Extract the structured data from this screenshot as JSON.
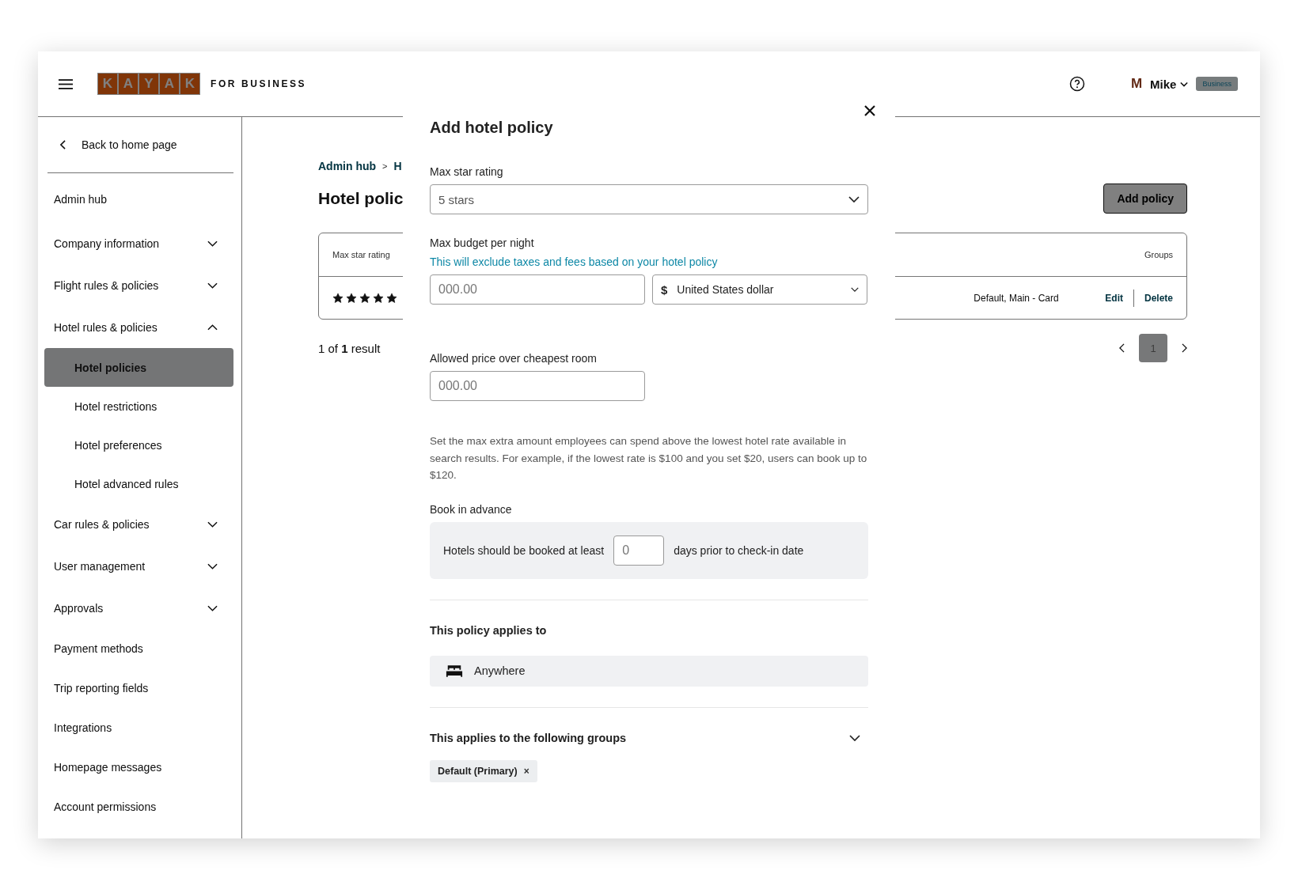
{
  "header": {
    "logo_letters": [
      "K",
      "A",
      "Y",
      "A",
      "K"
    ],
    "logo_suffix": "FOR BUSINESS",
    "user": {
      "avatar": "M",
      "name": "Mike",
      "badge": "Business"
    }
  },
  "sidebar": {
    "back": "Back to home page",
    "items": [
      {
        "label": "Admin hub",
        "kind": "link"
      },
      {
        "label": "Company information",
        "kind": "group",
        "expanded": false
      },
      {
        "label": "Flight rules & policies",
        "kind": "group",
        "expanded": false
      },
      {
        "label": "Hotel rules & policies",
        "kind": "group",
        "expanded": true,
        "children": [
          {
            "label": "Hotel policies",
            "selected": true
          },
          {
            "label": "Hotel restrictions",
            "selected": false
          },
          {
            "label": "Hotel preferences",
            "selected": false
          },
          {
            "label": "Hotel advanced rules",
            "selected": false
          }
        ]
      },
      {
        "label": "Car rules & policies",
        "kind": "group",
        "expanded": false
      },
      {
        "label": "User management",
        "kind": "group",
        "expanded": false
      },
      {
        "label": "Approvals",
        "kind": "group",
        "expanded": false
      },
      {
        "label": "Payment methods",
        "kind": "link"
      },
      {
        "label": "Trip reporting fields",
        "kind": "link"
      },
      {
        "label": "Integrations",
        "kind": "link"
      },
      {
        "label": "Homepage messages",
        "kind": "link"
      },
      {
        "label": "Account permissions",
        "kind": "link"
      }
    ]
  },
  "main": {
    "breadcrumb": [
      "Admin hub",
      "H"
    ],
    "breadcrumb_separator": ">",
    "title": "Hotel polic",
    "add_button": "Add policy",
    "table": {
      "columns": [
        "Max star rating",
        "Groups"
      ],
      "rows": [
        {
          "stars": 5,
          "groups": "Default, Main - Card",
          "actions": [
            "Edit",
            "Delete"
          ]
        }
      ]
    },
    "results": "1 of **1** result",
    "pagination": {
      "page": "1"
    }
  },
  "modal": {
    "title": "Add hotel policy",
    "star_rating": {
      "label": "Max star rating",
      "value": "5 stars"
    },
    "budget": {
      "label": "Max budget per night",
      "hint": "This will exclude taxes and fees based on your hotel policy",
      "placeholder": "000.00",
      "currency_symbol": "$",
      "currency": "United States dollar"
    },
    "allowed_price": {
      "label": "Allowed price over cheapest room",
      "placeholder": "000.00",
      "help": "Set the max extra amount employees can spend above the lowest hotel rate available in search results. For example, if the lowest rate is $100 and you set $20, users can book up to $120."
    },
    "advance": {
      "label": "Book in advance",
      "before": "Hotels should be booked at least",
      "value": "0",
      "after": "days prior to check-in date"
    },
    "applies_to": {
      "heading": "This policy applies to",
      "location": "Anywhere"
    },
    "groups": {
      "heading": "This applies to the following groups",
      "expanded": false,
      "chips": [
        {
          "label": "Default (Primary)",
          "remove": "×"
        }
      ]
    }
  }
}
